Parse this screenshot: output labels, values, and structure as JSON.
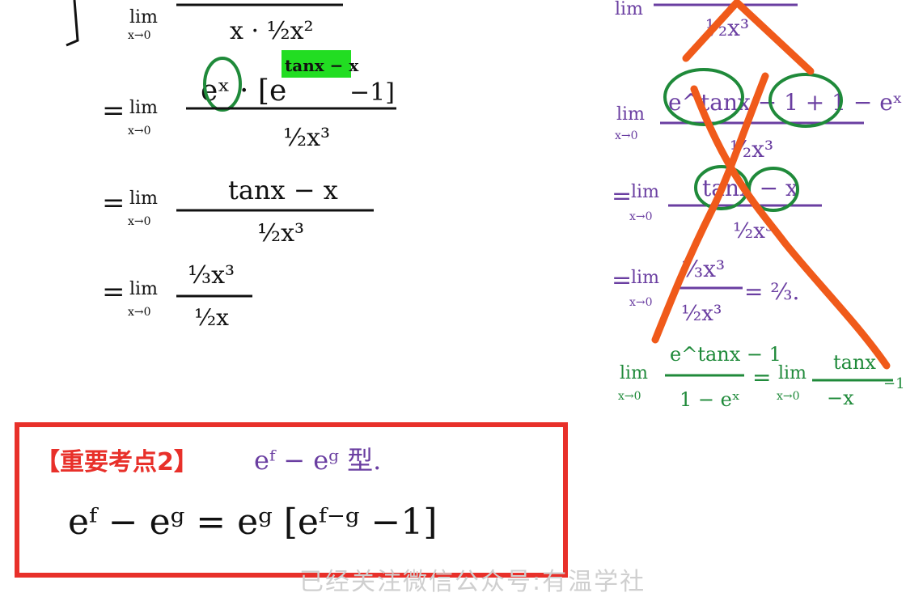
{
  "left": {
    "lim": "lim",
    "under": "x→0",
    "eq": "=",
    "step1": {
      "den": "x · ½x²"
    },
    "step2": {
      "num_main": "eˣ · [e",
      "num_exp": "tanx − x",
      "num_tail": "−1]",
      "den": "½x³"
    },
    "step3": {
      "num": "tanx − x",
      "den": "½x³"
    },
    "step4": {
      "num": "⅓x³",
      "den": "½x"
    }
  },
  "right": {
    "lim": "lim",
    "under": "x→0",
    "eq": "=",
    "r1": {
      "den": "½x³"
    },
    "r2": {
      "num": "e^tanx − 1 + 1 − eˣ",
      "den": "½x³"
    },
    "r3": {
      "num": "tanx − x",
      "den": "½x³"
    },
    "r4": {
      "num": "⅓x³",
      "den": "½x³",
      "result": "= ⅔."
    },
    "green": {
      "num1": "e^tanx − 1",
      "den1": "1 − eˣ",
      "num2": "tanx",
      "den2": "−x",
      "tail": "−1"
    }
  },
  "topic": {
    "title": "【重要考点2】",
    "note": "eᶠ − eᵍ 型.",
    "formula": "eᶠ − eᵍ = eᵍ [eᶠ⁻ᵍ −1]"
  },
  "caption": "已经关注微信公众号:有温学社",
  "colors": {
    "ink": "#111111",
    "purple": "#6a3ea1",
    "green": "#1f8a3a",
    "orange": "#f05a1a",
    "red": "#e8302a",
    "highlight": "#22dd22"
  }
}
